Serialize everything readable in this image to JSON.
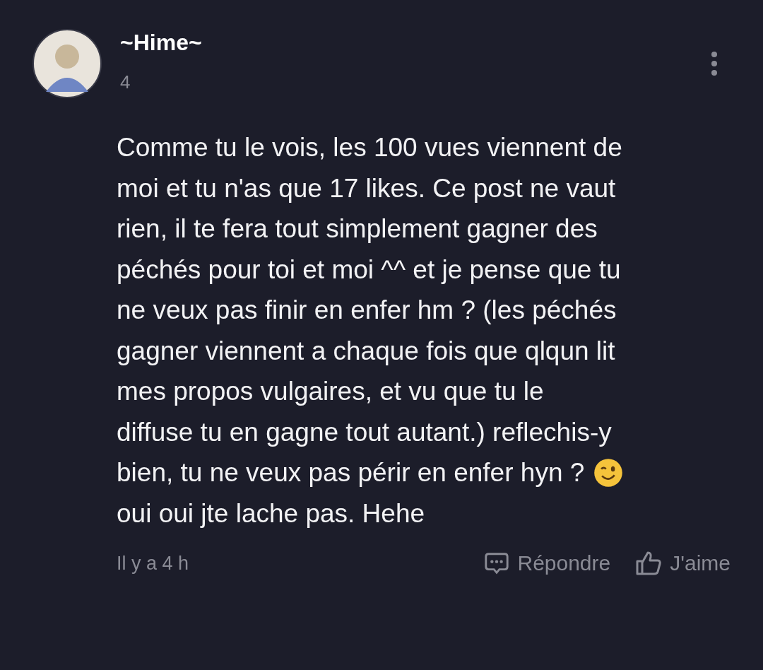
{
  "comment": {
    "author": "~Hime~",
    "subtitle": "4",
    "body": [
      [
        {
          "kind": "text",
          "text": "Comme tu le vois, les 100 vues viennent de"
        }
      ],
      [
        {
          "kind": "text",
          "text": "moi et tu n'as que 17 likes. Ce post ne vaut"
        }
      ],
      [
        {
          "kind": "text",
          "text": "rien, il te fera tout simplement gagner des"
        }
      ],
      [
        {
          "kind": "text",
          "text": "péchés pour toi et moi ^^ et je pense que tu"
        }
      ],
      [
        {
          "kind": "text",
          "text": "ne veux pas finir en enfer hm ? (les péchés"
        }
      ],
      [
        {
          "kind": "text",
          "text": "gagner viennent a chaque fois que qlqun lit"
        }
      ],
      [
        {
          "kind": "text",
          "text": "mes propos vulgaires, et vu que tu le"
        }
      ],
      [
        {
          "kind": "text",
          "text": "diffuse tu en gagne tout autant.) reflechis-y"
        }
      ],
      [
        {
          "kind": "text",
          "text": "bien, tu ne veux pas périr en enfer hyn ?"
        },
        {
          "kind": "wink"
        }
      ],
      [
        {
          "kind": "text",
          "text": "oui oui jte lache pas. Hehe"
        }
      ]
    ],
    "time": "Il y a 4 h",
    "actions": [
      {
        "kind": "reply",
        "label": "Répondre"
      },
      {
        "kind": "like",
        "label": "J'aime"
      }
    ]
  }
}
